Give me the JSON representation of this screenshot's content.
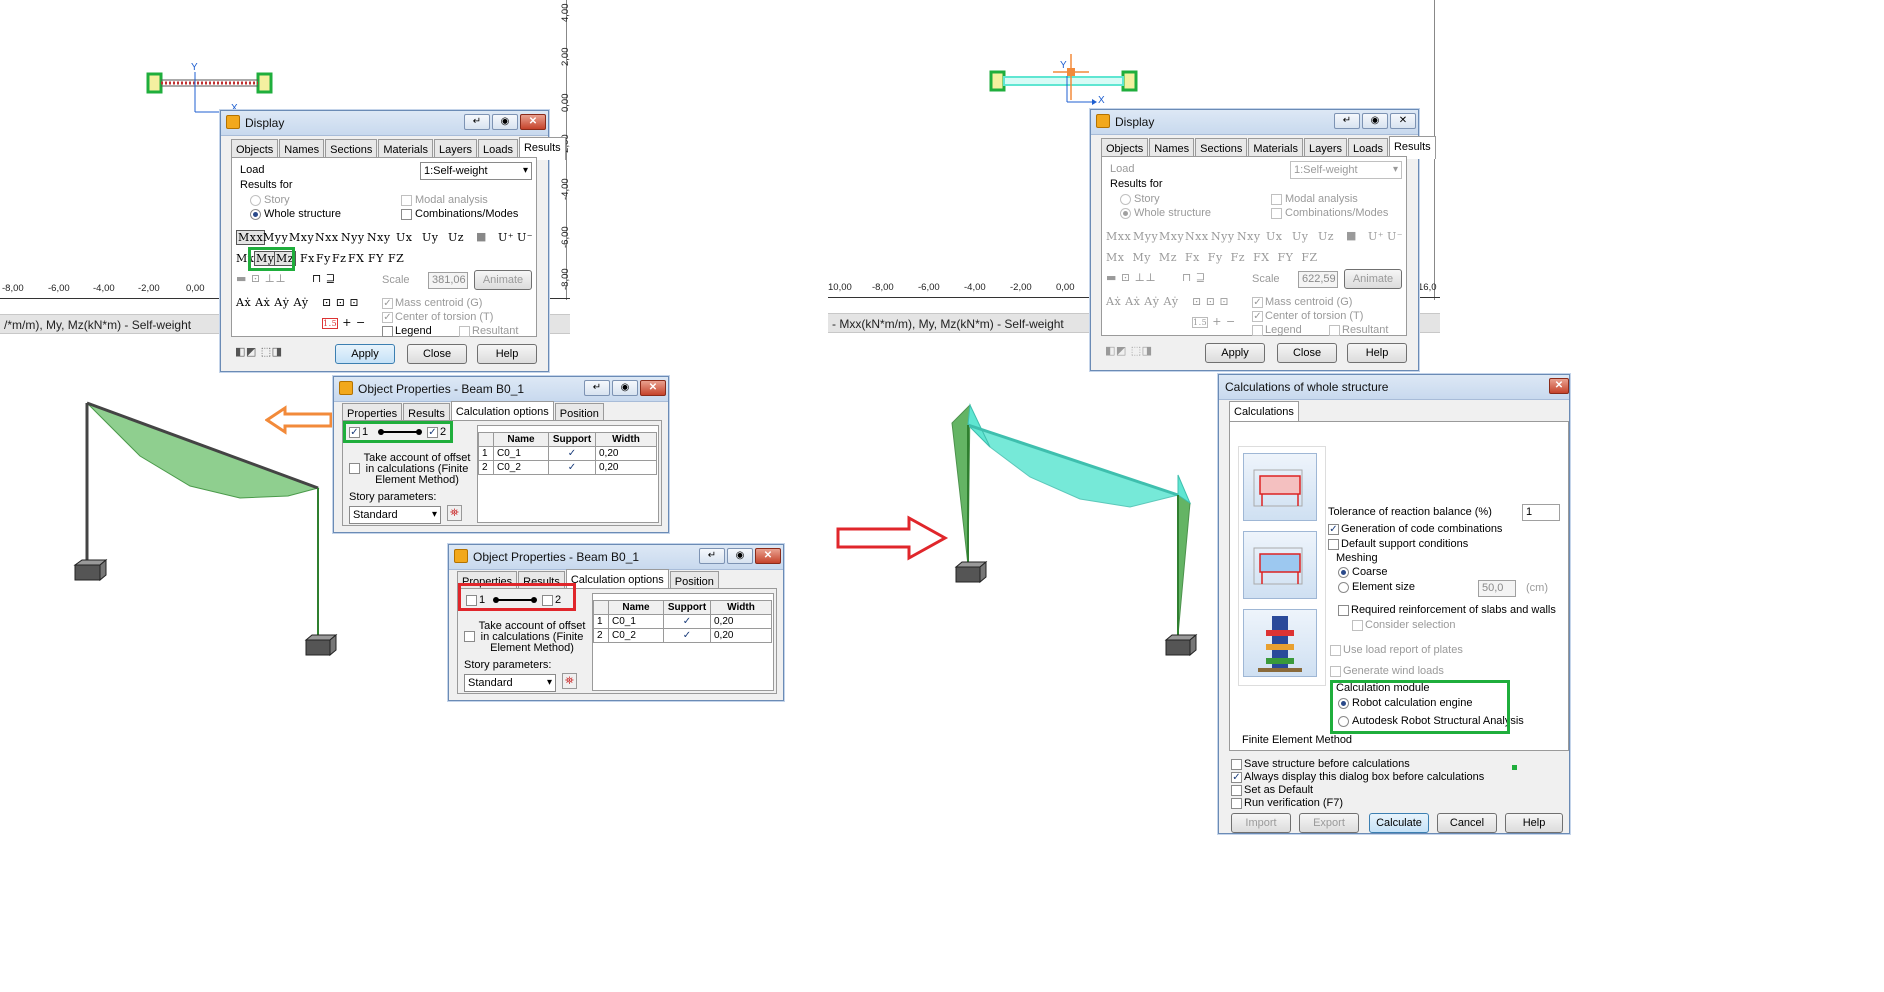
{
  "left": {
    "status_text": "/*m/m), My, Mz(kN*m) - Self-weight",
    "h_ruler": [
      "-8,00",
      "-6,00",
      "-4,00",
      "-2,00",
      "0,00"
    ],
    "v_ruler": [
      "4,00",
      "2,00",
      "0,00",
      "-2,00",
      "-4,00",
      "-6,00",
      "-8,00"
    ],
    "axis_y": "Y",
    "axis_x": "X",
    "display": {
      "title": "Display",
      "tabs": [
        "Objects",
        "Names",
        "Sections",
        "Materials",
        "Layers",
        "Loads",
        "Results"
      ],
      "load_label": "Load",
      "load_value": "1:Self-weight",
      "results_for": "Results for",
      "story": "Story",
      "whole_structure": "Whole structure",
      "modal_analysis": "Modal analysis",
      "combinations": "Combinations/Modes",
      "row1": [
        "Mxx",
        "Myy",
        "Mxy",
        "Nxx",
        "Nyy",
        "Nxy",
        "Ux",
        "Uy",
        "Uz",
        "■",
        "U⁺",
        "U⁻"
      ],
      "row2_mx": "Mx",
      "row2_my": "My",
      "row2_mz": "Mz",
      "row2_rest": [
        "Fx",
        "Fy",
        "Fz",
        "FX",
        "FY",
        "FZ"
      ],
      "scale_label": "Scale",
      "scale_value": "381,06",
      "animate": "Animate",
      "mass_centroid": "Mass centroid (G)",
      "center_torsion": "Center of torsion (T)",
      "legend": "Legend",
      "resultant": "Resultant",
      "apply": "Apply",
      "close": "Close",
      "help": "Help"
    },
    "obj1": {
      "title": "Object Properties - Beam B0_1",
      "tabs": [
        "Properties",
        "Results",
        "Calculation options",
        "Position"
      ],
      "node1": "1",
      "node2": "2",
      "offset_text": "Take account of offset in calculations (Finite Element Method)",
      "story_params": "Story parameters:",
      "story_value": "Standard",
      "table_head": [
        "",
        "Name",
        "Support",
        "Width"
      ],
      "rows": [
        [
          "1",
          "C0_1",
          "✓",
          "0,20"
        ],
        [
          "2",
          "C0_2",
          "✓",
          "0,20"
        ]
      ]
    },
    "obj2": {
      "title": "Object Properties - Beam B0_1",
      "tabs": [
        "Properties",
        "Results",
        "Calculation options",
        "Position"
      ],
      "node1": "1",
      "node2": "2",
      "offset_text": "Take account of offset in calculations (Finite Element Method)",
      "story_params": "Story parameters:",
      "story_value": "Standard",
      "table_head": [
        "",
        "Name",
        "Support",
        "Width"
      ],
      "rows": [
        [
          "1",
          "C0_1",
          "✓",
          "0,20"
        ],
        [
          "2",
          "C0_2",
          "✓",
          "0,20"
        ]
      ]
    }
  },
  "right": {
    "status_text": "- Mxx(kN*m/m), My, Mz(kN*m) - Self-weight",
    "h_ruler": [
      "10,00",
      "-8,00",
      "-6,00",
      "-4,00",
      "-2,00",
      "0,00",
      "16,0"
    ],
    "axis_y": "Y",
    "axis_x": "X",
    "display": {
      "title": "Display",
      "tabs": [
        "Objects",
        "Names",
        "Sections",
        "Materials",
        "Layers",
        "Loads",
        "Results"
      ],
      "load_label": "Load",
      "load_value": "1:Self-weight",
      "results_for": "Results for",
      "story": "Story",
      "whole_structure": "Whole structure",
      "modal_analysis": "Modal analysis",
      "combinations": "Combinations/Modes",
      "row1": [
        "Mxx",
        "Myy",
        "Mxy",
        "Nxx",
        "Nyy",
        "Nxy",
        "Ux",
        "Uy",
        "Uz",
        "■",
        "U⁺",
        "U⁻"
      ],
      "row2": "Mx  My  Mz  Fx  Fy  Fz  FX  FY  FZ",
      "scale_label": "Scale",
      "scale_value": "622,59",
      "animate": "Animate",
      "mass_centroid": "Mass centroid (G)",
      "center_torsion": "Center of torsion (T)",
      "legend": "Legend",
      "resultant": "Resultant",
      "apply": "Apply",
      "close": "Close",
      "help": "Help"
    },
    "calc": {
      "title": "Calculations of whole structure",
      "tab": "Calculations",
      "tolerance_label": "Tolerance of reaction balance (%)",
      "tolerance_value": "1",
      "gen_code_comb": "Generation of code combinations",
      "default_support": "Default support conditions",
      "meshing": "Meshing",
      "coarse": "Coarse",
      "element_size": "Element size",
      "element_size_value": "50,0",
      "element_size_unit": "(cm)",
      "required_reinf": "Required reinforcement of slabs and walls",
      "consider_sel": "Consider selection",
      "use_load_report": "Use load report of plates",
      "gen_wind": "Generate wind loads",
      "calc_module": "Calculation module",
      "robot_engine": "Robot calculation engine",
      "autodesk_rsa": "Autodesk Robot Structural Analysis",
      "fem": "Finite Element Method",
      "save_structure": "Save structure before calculations",
      "always_display": "Always display this dialog box before calculations",
      "set_default": "Set as Default",
      "run_verification": "Run verification (F7)",
      "import": "Import",
      "export": "Export",
      "calculate": "Calculate",
      "cancel": "Cancel",
      "help": "Help"
    }
  },
  "colors": {
    "highlight_green": "#1fae3c",
    "highlight_red": "#e0262b",
    "arrow_orange": "#f28a3a",
    "diagram_green": "#8fcf8f",
    "diagram_cyan": "#5fe6d2"
  }
}
